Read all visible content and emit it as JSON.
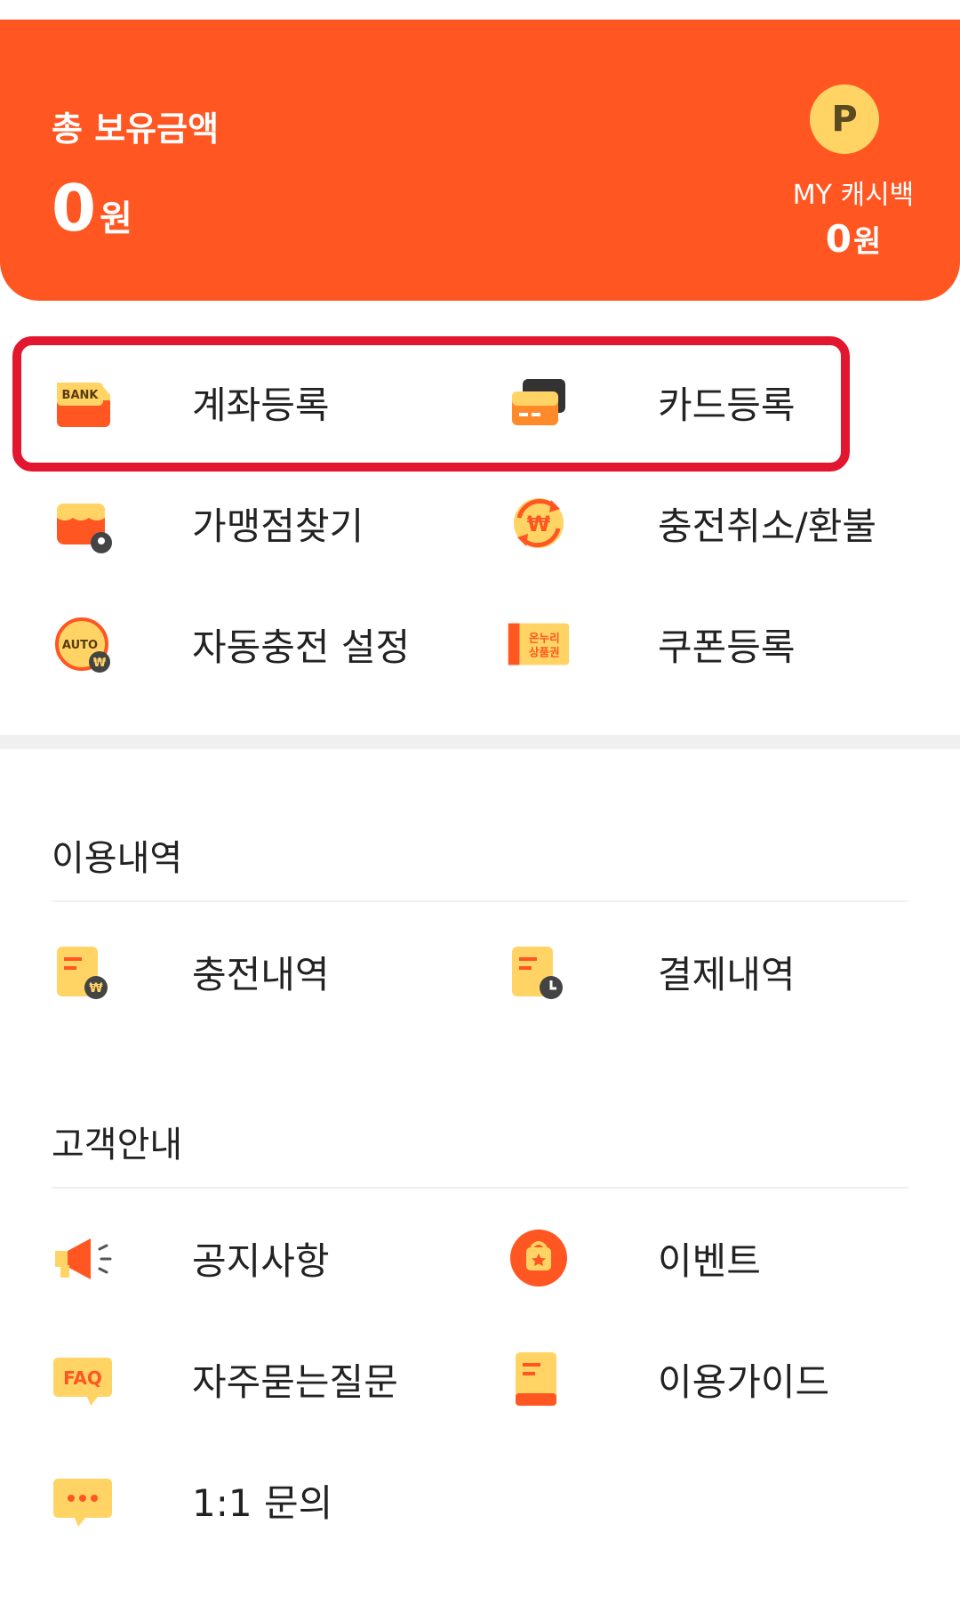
{
  "balance": {
    "label": "총 보유금액",
    "amount": "0",
    "unit": "원"
  },
  "cashback": {
    "badge": "P",
    "label": "MY 캐시백",
    "amount": "0",
    "unit": "원"
  },
  "quick_menu": {
    "account_register": {
      "label": "계좌등록",
      "icon": "bank-icon"
    },
    "card_register": {
      "label": "카드등록",
      "icon": "card-icon"
    },
    "store_finder": {
      "label": "가맹점찾기",
      "icon": "store-location-icon"
    },
    "charge_cancel": {
      "label": "충전취소/환불",
      "icon": "refund-won-icon"
    },
    "auto_charge": {
      "label": "자동충전 설정",
      "icon": "auto-charge-icon"
    },
    "coupon_register": {
      "label": "쿠폰등록",
      "icon": "onnuri-voucher-icon",
      "icon_text": "온누리\n상품권"
    }
  },
  "usage_history": {
    "title": "이용내역",
    "charge_history": {
      "label": "충전내역",
      "icon": "charge-history-icon"
    },
    "payment_history": {
      "label": "결제내역",
      "icon": "payment-history-icon"
    }
  },
  "customer_guide": {
    "title": "고객안내",
    "notice": {
      "label": "공지사항",
      "icon": "megaphone-icon"
    },
    "event": {
      "label": "이벤트",
      "icon": "event-icon"
    },
    "faq": {
      "label": "자주묻는질문",
      "icon": "faq-icon",
      "icon_text": "FAQ"
    },
    "usage_guide": {
      "label": "이용가이드",
      "icon": "guide-book-icon"
    },
    "inquiry": {
      "label": "1:1 문의",
      "icon": "chat-bubble-icon"
    }
  },
  "bank_icon_text": "BANK",
  "auto_icon_text": "AUTO",
  "colors": {
    "accent": "#ff5622",
    "badge": "#ffd465",
    "highlight": "#e3162f",
    "icon_yellow": "#ffd465",
    "icon_orange": "#ff5622"
  }
}
